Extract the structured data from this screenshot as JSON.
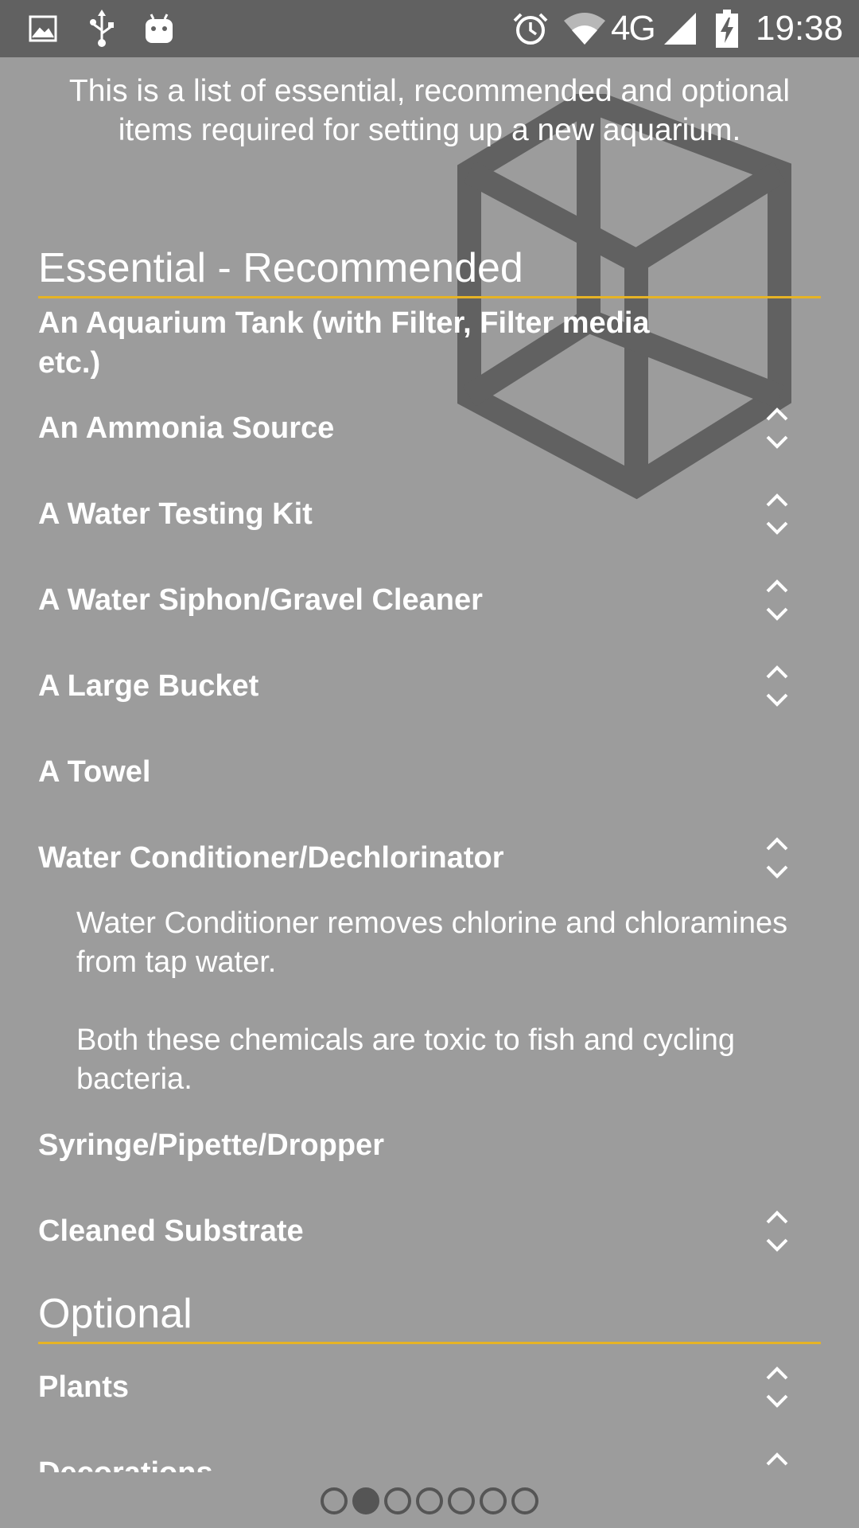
{
  "status_bar": {
    "left_icons": [
      "image-icon",
      "usb-icon",
      "android-debug-icon"
    ],
    "right_icons": [
      "alarm-icon",
      "wifi-icon",
      "signal-icon",
      "battery-charging-icon"
    ],
    "network_type": "4G",
    "time": "19:38"
  },
  "intro_text": "This is a list of essential, recommended and optional items required for setting up a new aquarium.",
  "sections": {
    "essential": {
      "title": "Essential - Recommended",
      "items": [
        {
          "title": "An Aquarium Tank (with Filter, Filter media etc.)",
          "expandable": false
        },
        {
          "title": "An Ammonia Source",
          "expandable": true
        },
        {
          "title": "A Water Testing Kit",
          "expandable": true
        },
        {
          "title": "A Water Siphon/Gravel Cleaner",
          "expandable": true
        },
        {
          "title": "A Large Bucket",
          "expandable": true
        },
        {
          "title": "A Towel",
          "expandable": false
        },
        {
          "title": "Water Conditioner/Dechlorinator",
          "expandable": true,
          "expanded": true,
          "description": [
            "Water Conditioner removes chlorine and chloramines from tap water.",
            "Both these chemicals are toxic to fish and cycling bacteria."
          ]
        },
        {
          "title": "Syringe/Pipette/Dropper",
          "expandable": false
        },
        {
          "title": "Cleaned Substrate",
          "expandable": true
        }
      ]
    },
    "optional": {
      "title": "Optional",
      "items": [
        {
          "title": "Plants",
          "expandable": true
        },
        {
          "title": "Decorations",
          "expandable": true
        }
      ]
    }
  },
  "pager": {
    "page_count": 7,
    "current_page": 2
  },
  "colors": {
    "background": "#9c9c9c",
    "status_bar": "#616161",
    "accent_underline": "#e6b325",
    "watermark": "#616161",
    "text": "#ffffff"
  }
}
